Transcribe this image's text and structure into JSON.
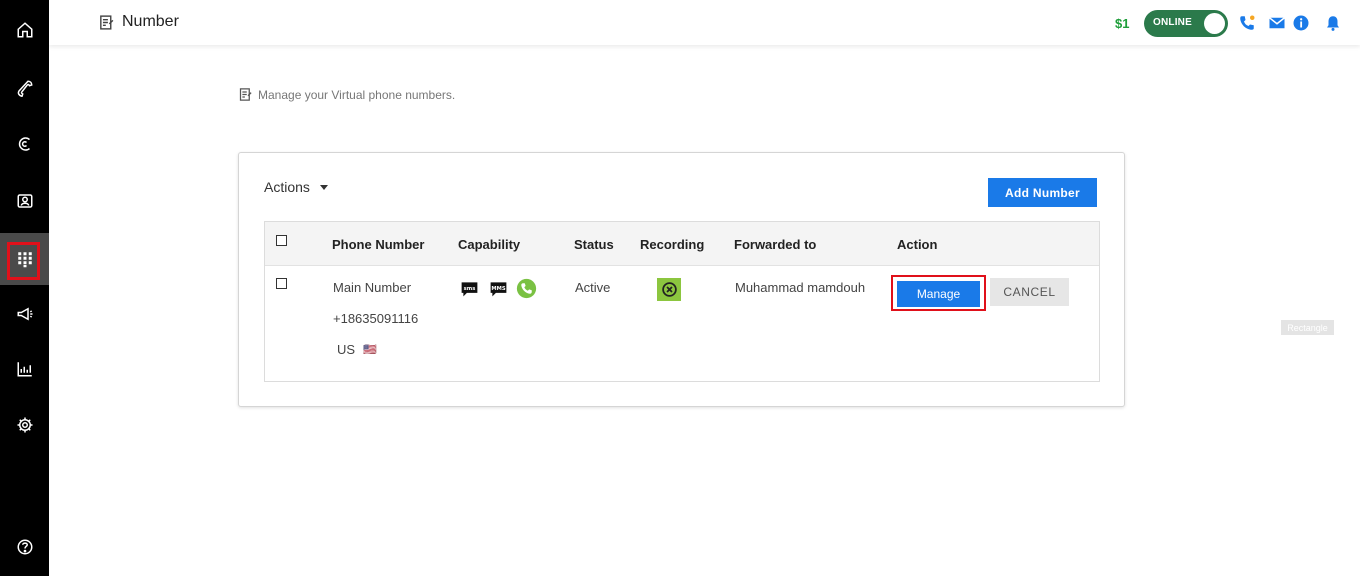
{
  "header": {
    "title": "Number",
    "balance": "$1",
    "status_toggle": "ONLINE"
  },
  "sidebar": {
    "items": [
      {
        "icon": "home-icon"
      },
      {
        "icon": "phone-icon"
      },
      {
        "icon": "call-forward-icon"
      },
      {
        "icon": "contacts-icon"
      },
      {
        "icon": "dialpad-icon",
        "active": true
      },
      {
        "icon": "megaphone-icon"
      },
      {
        "icon": "analytics-icon"
      },
      {
        "icon": "settings-icon"
      },
      {
        "icon": "help-icon"
      }
    ]
  },
  "subtitle": "Manage your Virtual phone numbers.",
  "card": {
    "actions_label": "Actions",
    "add_button": "Add Number",
    "columns": [
      "Phone Number",
      "Capability",
      "Status",
      "Recording",
      "Forwarded to",
      "Action"
    ],
    "rows": [
      {
        "name": "Main Number",
        "number": "+18635091116",
        "country": "US",
        "flag": "🇺🇸",
        "capabilities": [
          "sms-icon",
          "mms-icon",
          "voice-icon"
        ],
        "status": "Active",
        "recording_icon": "recording-off-icon",
        "forwarded_to": "Muhammad mamdouh",
        "manage_label": "Manage",
        "cancel_label": "CANCEL"
      }
    ]
  },
  "overlay_tag": "Rectangle",
  "colors": {
    "primary": "#1a7ae8",
    "online": "#2b7a4b",
    "balance": "#1e9e3a",
    "recording": "#8cc63f",
    "highlight": "#e0101a"
  }
}
